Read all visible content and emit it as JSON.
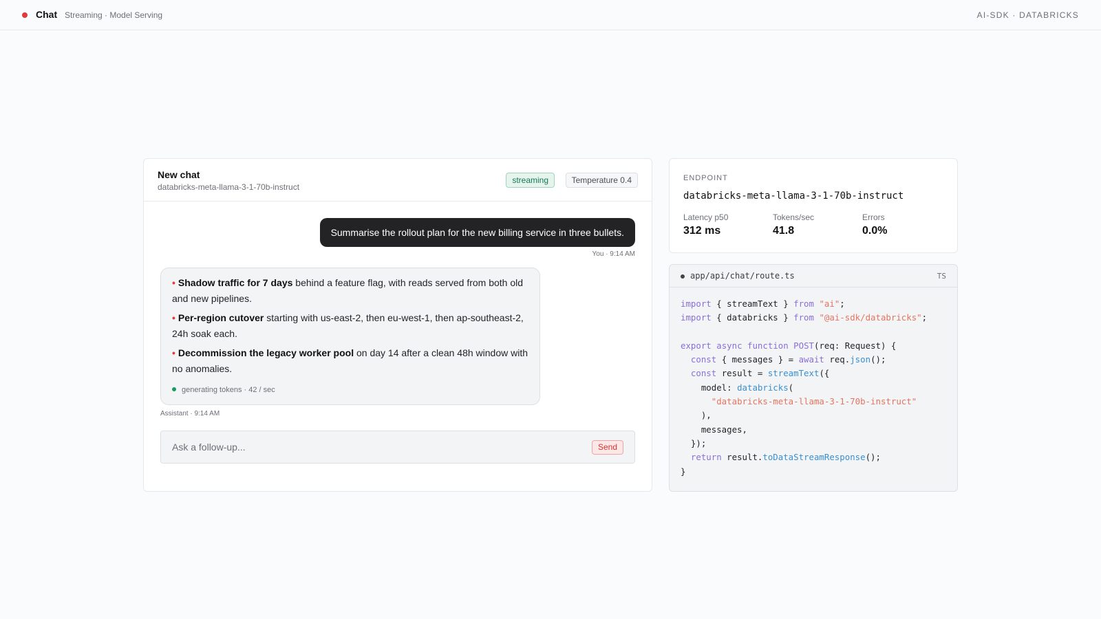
{
  "topbar": {
    "title": "Chat",
    "subtitle": "Streaming · Model Serving",
    "brand": "AI-SDK · DATABRICKS"
  },
  "chat": {
    "title": "New chat",
    "model": "databricks-meta-llama-3-1-70b-instruct",
    "status_badge": "streaming",
    "temperature_badge": "Temperature 0.4",
    "user_message": {
      "text": "Summarise the rollout plan for the new billing service in three bullets.",
      "meta": "You · 9:14 AM"
    },
    "assistant_message": {
      "bullets": [
        {
          "marker": "•",
          "bold": "Shadow traffic for 7 days",
          "rest": " behind a feature flag, with reads served from both old and new pipelines."
        },
        {
          "marker": "•",
          "bold": "Per-region cutover",
          "rest": " starting with us-east-2, then eu-west-1, then ap-southeast-2, 24h soak each."
        },
        {
          "marker": "•",
          "bold": "Decommission the legacy worker pool",
          "rest": " on day 14 after a clean 48h window with no anomalies."
        }
      ],
      "status": "generating tokens · 42 / sec",
      "meta": "Assistant · 9:14 AM"
    },
    "composer": {
      "placeholder": "Ask a follow-up...",
      "send_label": "Send"
    }
  },
  "endpoint": {
    "label": "ENDPOINT",
    "name": "databricks-meta-llama-3-1-70b-instruct",
    "metrics": [
      {
        "label": "Latency p50",
        "value": "312 ms"
      },
      {
        "label": "Tokens/sec",
        "value": "41.8"
      },
      {
        "label": "Errors",
        "value": "0.0%"
      }
    ]
  },
  "code": {
    "file": "app/api/chat/route.ts",
    "lang": "TS",
    "tokens": {
      "import": "import",
      "from": "from",
      "export": "export",
      "async": "async",
      "function": "function",
      "const": "const",
      "await": "await",
      "return": "return",
      "streamText": "streamText",
      "databricks": "databricks",
      "ai_str": "\"ai\"",
      "sdk_str": "\"@ai-sdk/databricks\"",
      "POST": "POST",
      "json": "json",
      "model_str": "\"databricks-meta-llama-3-1-70b-instruct\"",
      "toDataStreamResponse": "toDataStreamResponse",
      "import1_mid": " { streamText } ",
      "import2_mid": " { databricks } ",
      "semi": ";",
      "sig_rest": "(req: Request) {",
      "messages_destructure": " { messages } = ",
      "req_dot": " req.",
      "call_end": "();",
      "result_assign": " result = ",
      "open_call": "({",
      "model_key": "    model: ",
      "open_paren": "(",
      "close_paren": "    ),",
      "messages_line": "    messages,",
      "close_obj": "  });",
      "result_dot": " result.",
      "close_brace": "}"
    }
  },
  "colors": {
    "accent_red": "#e03a3a",
    "streaming_green": "#16794f",
    "user_bubble": "#232325"
  },
  "icons": [
    "status-dot-icon",
    "generating-dot-icon",
    "file-dot-icon"
  ]
}
